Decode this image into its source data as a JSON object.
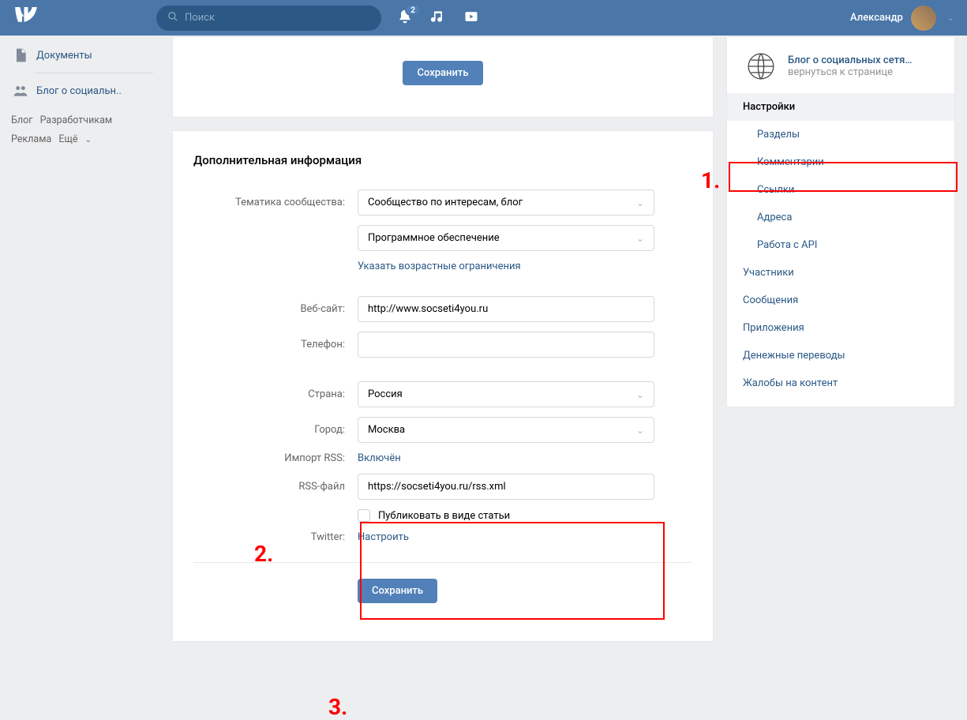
{
  "header": {
    "search_placeholder": "Поиск",
    "notifications_badge": "2",
    "username": "Александр"
  },
  "left_nav": {
    "items": [
      {
        "label": "Документы"
      },
      {
        "label": "Блог о социальн.."
      }
    ],
    "footer": {
      "blog": "Блог",
      "developers": "Разработчикам",
      "ads": "Реклама",
      "more": "Ещё"
    }
  },
  "save_button": "Сохранить",
  "section_title": "Дополнительная информация",
  "form": {
    "topic_label": "Тематика сообщества:",
    "topic_value": "Сообщество по интересам, блог",
    "topic_subvalue": "Программное обеспечение",
    "age_link": "Указать возрастные ограничения",
    "website_label": "Веб-сайт:",
    "website_value": "http://www.socseti4you.ru",
    "phone_label": "Телефон:",
    "phone_value": "",
    "country_label": "Страна:",
    "country_value": "Россия",
    "city_label": "Город:",
    "city_value": "Москва",
    "rss_label": "Импорт RSS:",
    "rss_status": "Включён",
    "rssfile_label": "RSS-файл",
    "rssfile_value": "https://socseti4you.ru/rss.xml",
    "publish_article": "Публиковать в виде статьи",
    "twitter_label": "Twitter:",
    "twitter_link": "Настроить"
  },
  "sidebar": {
    "blog_title": "Блог о социальных сетя…",
    "blog_subtitle": "вернуться к странице",
    "items": {
      "settings": "Настройки",
      "sections": "Разделы",
      "comments": "Комментарии",
      "links": "Ссылки",
      "addresses": "Адреса",
      "api": "Работа с API",
      "members": "Участники",
      "messages": "Сообщения",
      "apps": "Приложения",
      "transfers": "Денежные переводы",
      "complaints": "Жалобы на контент"
    }
  },
  "annotations": {
    "n1": "1.",
    "n2": "2.",
    "n3": "3."
  }
}
